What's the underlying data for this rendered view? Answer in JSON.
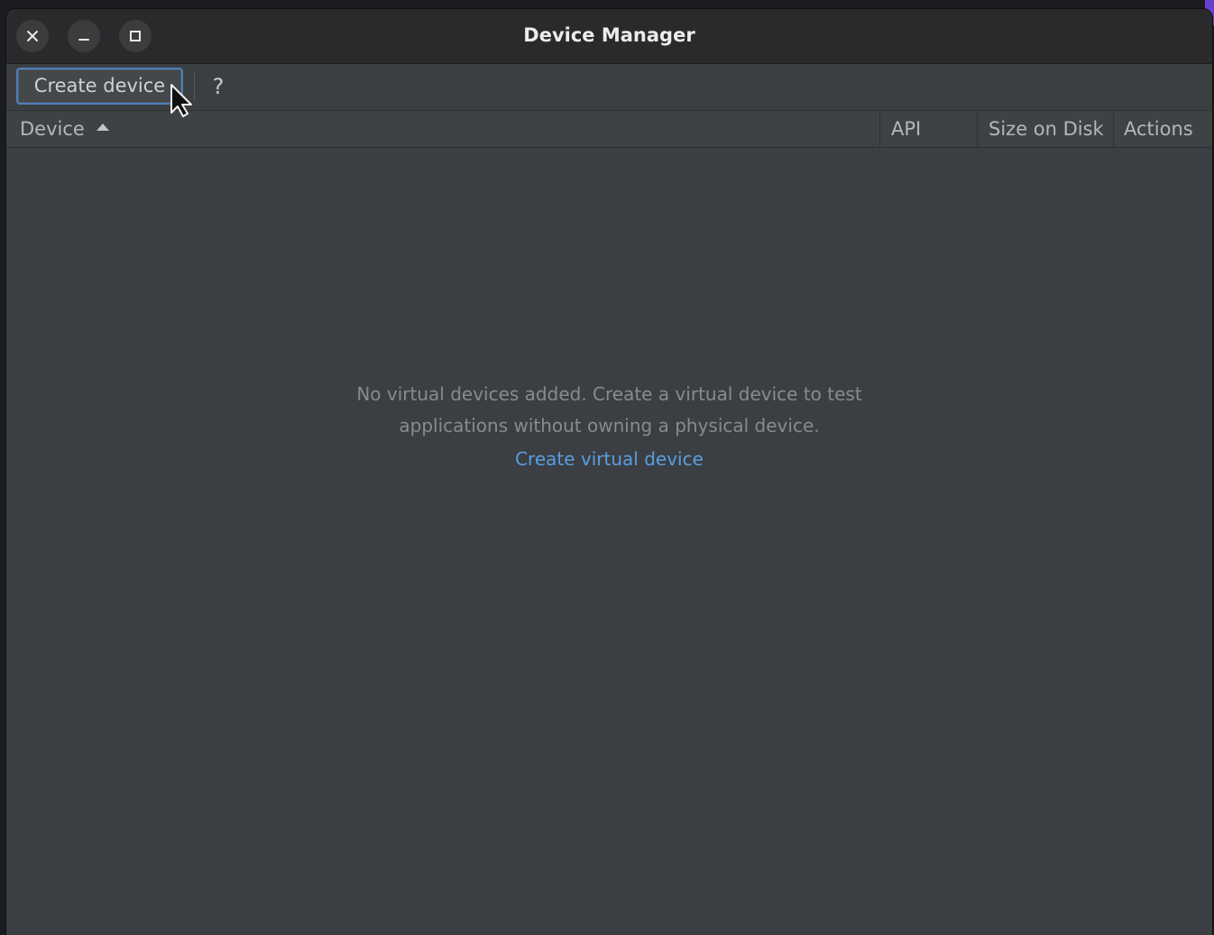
{
  "window": {
    "title": "Device Manager",
    "controls": {
      "close_icon": "close-icon",
      "minimize_icon": "minimize-icon",
      "maximize_icon": "maximize-icon"
    }
  },
  "toolbar": {
    "create_label": "Create device",
    "help_label": "?"
  },
  "table": {
    "columns": [
      {
        "label": "Device",
        "sort": "ascending"
      },
      {
        "label": "API"
      },
      {
        "label": "Size on Disk"
      },
      {
        "label": "Actions"
      }
    ],
    "rows": []
  },
  "empty_state": {
    "line1": "No virtual devices added. Create a virtual device to test",
    "line2": "applications without owning a physical device.",
    "link_label": "Create virtual device"
  },
  "colors": {
    "link": "#5a9de0",
    "focus_border": "#4b7fc0",
    "panel_background": "#3b3f43",
    "titlebar_background": "#2a2a2c"
  }
}
